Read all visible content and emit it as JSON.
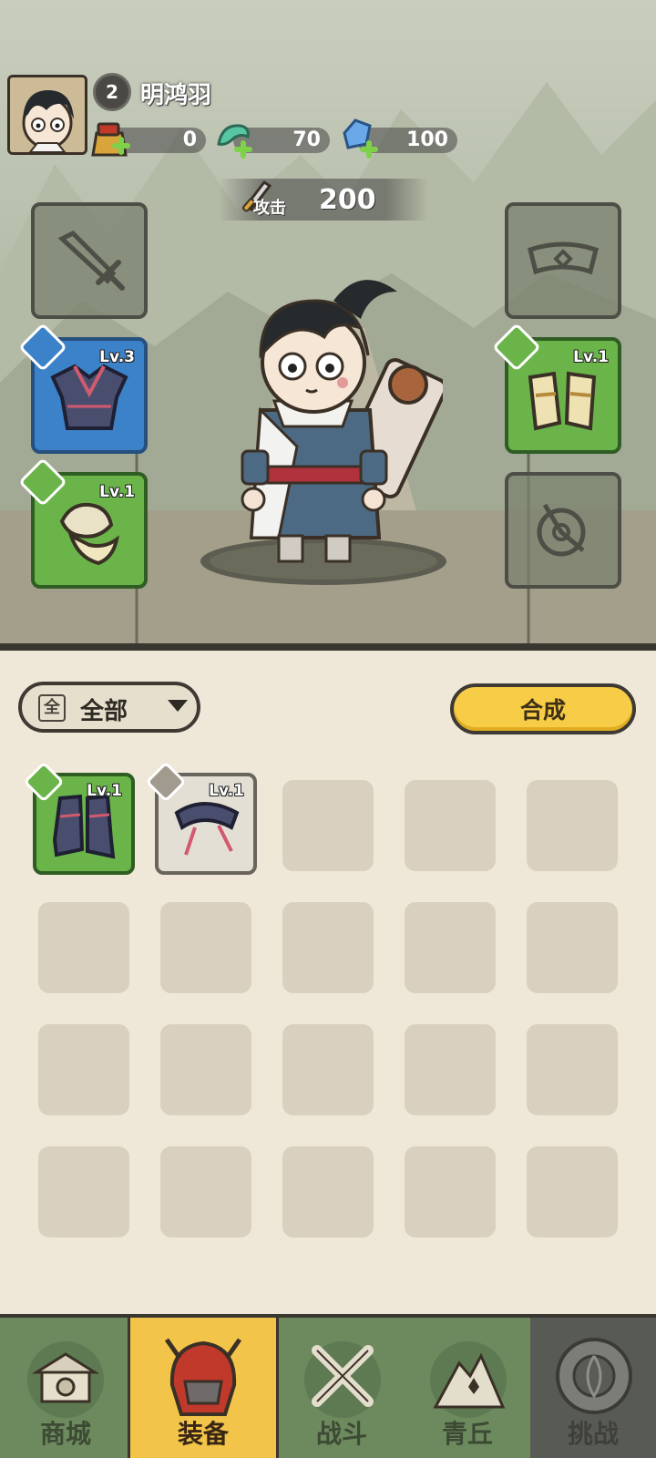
{
  "player": {
    "name": "明鸿羽",
    "level": "2"
  },
  "resources": [
    {
      "icon": "coin-pouch-icon",
      "value": "0"
    },
    {
      "icon": "jade-dragon-icon",
      "value": "70"
    },
    {
      "icon": "blue-crystal-icon",
      "value": "100"
    }
  ],
  "attack": {
    "label": "攻击",
    "value": "200"
  },
  "equipment": {
    "weapon": {
      "level": ""
    },
    "armor": {
      "level": "Lv.3",
      "quality": "blue"
    },
    "helmet": {
      "level": "Lv.1",
      "quality": "green"
    },
    "belt": {
      "level": ""
    },
    "boots": {
      "level": "Lv.1",
      "quality": "green"
    },
    "accessory": {
      "level": ""
    }
  },
  "inventory": {
    "filter": {
      "box_char": "全",
      "label": "全部"
    },
    "compose_label": "合成",
    "items": [
      {
        "name": "dark-boots",
        "level": "Lv.1",
        "quality": "green"
      },
      {
        "name": "dark-belt",
        "level": "Lv.1",
        "quality": "grey"
      }
    ]
  },
  "nav": {
    "tabs": [
      {
        "label": "商城",
        "icon": "shop-icon",
        "state": "normal"
      },
      {
        "label": "装备",
        "icon": "helmet-icon",
        "state": "active"
      },
      {
        "label": "战斗",
        "icon": "crossed-swords-icon",
        "state": "normal"
      },
      {
        "label": "青丘",
        "icon": "mountain-icon",
        "state": "normal"
      },
      {
        "label": "挑战",
        "icon": "challenge-icon",
        "state": "locked"
      }
    ]
  },
  "colors": {
    "accent_yellow": "#f7cc46",
    "quality_green": "#6bb44a",
    "quality_blue": "#3c82c8",
    "nav_green": "#6c8a5e"
  }
}
